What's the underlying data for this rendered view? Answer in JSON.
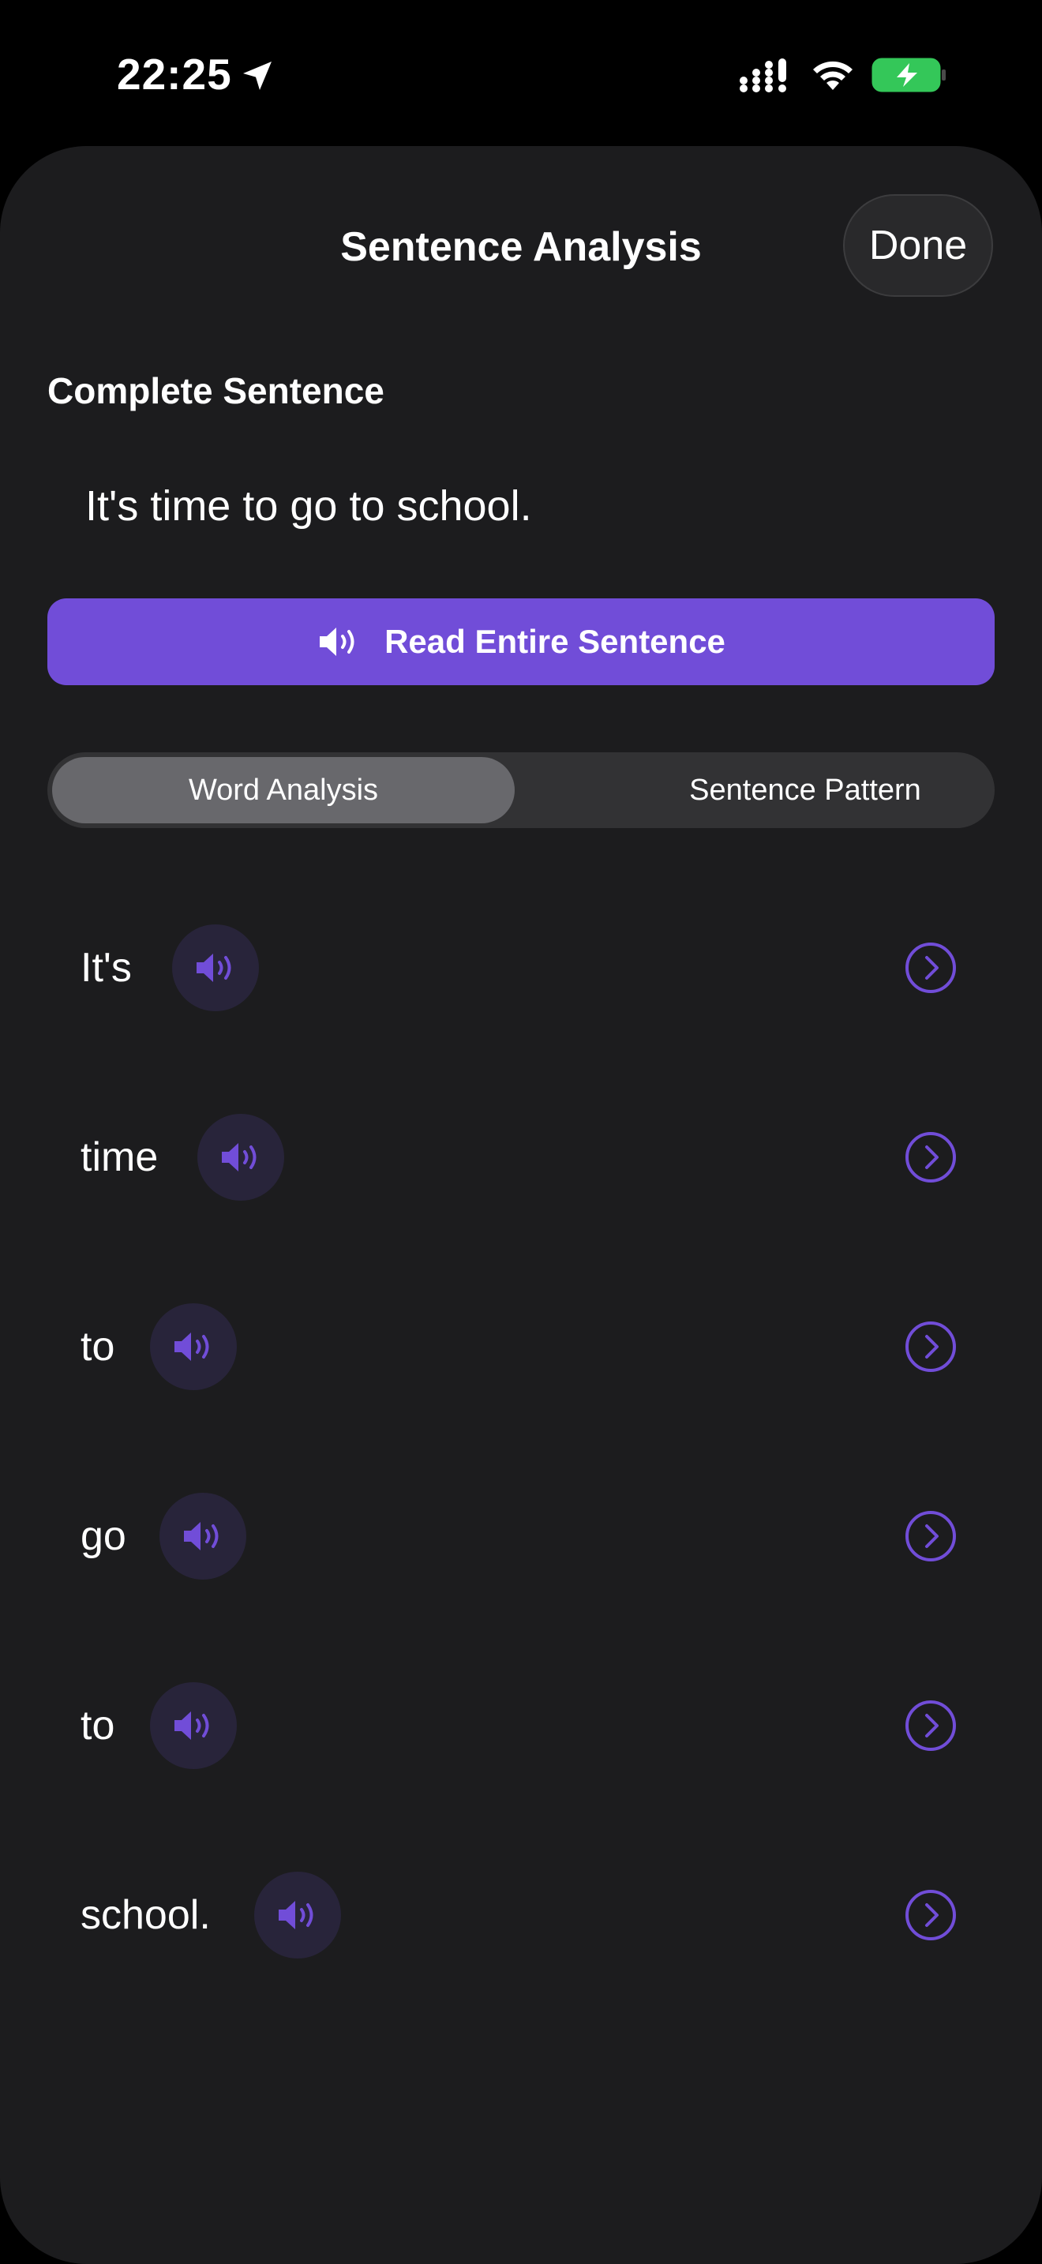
{
  "status_bar": {
    "time": "22:25"
  },
  "header": {
    "title": "Sentence Analysis",
    "done_label": "Done"
  },
  "complete_sentence": {
    "heading": "Complete Sentence",
    "text": "It's time to go to school."
  },
  "read_button": {
    "label": "Read Entire Sentence",
    "icon": "speaker-icon"
  },
  "segmented_control": {
    "options": [
      "Word Analysis",
      "Sentence Pattern"
    ],
    "selected": "Word Analysis"
  },
  "words": [
    {
      "text": "It's"
    },
    {
      "text": "time"
    },
    {
      "text": "to"
    },
    {
      "text": "go"
    },
    {
      "text": "to"
    },
    {
      "text": "school."
    }
  ],
  "colors": {
    "accent": "#714dd8",
    "sheet_background": "#1c1c1e",
    "battery_green": "#34c759"
  }
}
